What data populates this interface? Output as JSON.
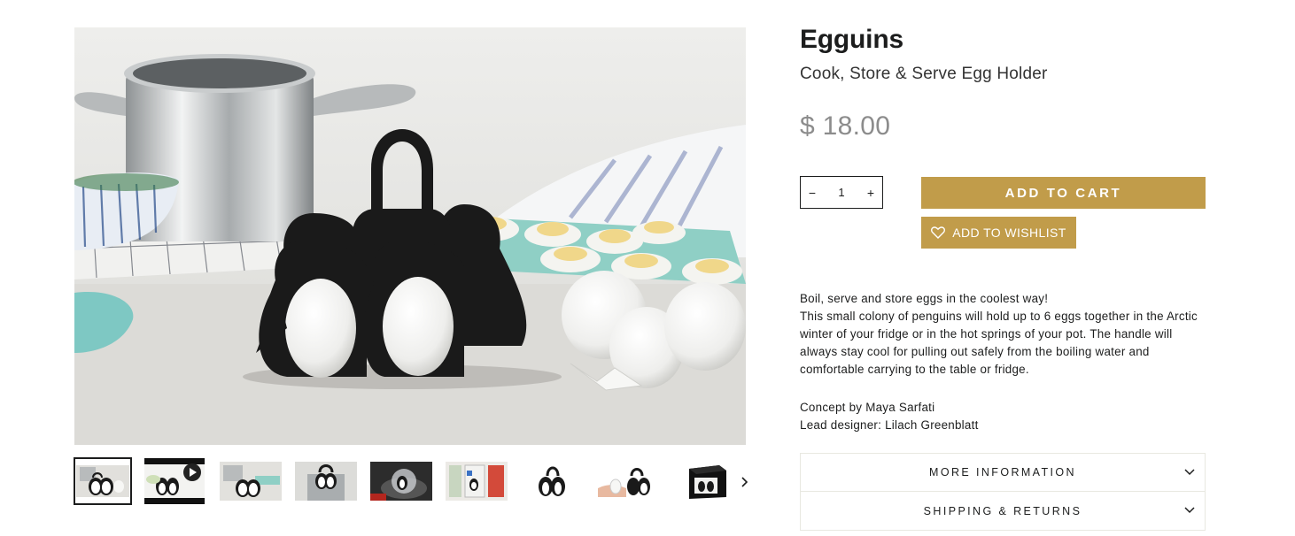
{
  "product": {
    "title": "Egguins",
    "subtitle": "Cook, Store & Serve Egg Holder",
    "price": "$ 18.00"
  },
  "quantity": {
    "value": "1",
    "decrement_symbol": "−",
    "increment_symbol": "+"
  },
  "buttons": {
    "add_to_cart": "ADD TO CART",
    "add_to_wishlist": "ADD TO WISHLIST"
  },
  "description": {
    "lines": [
      "Boil, serve and store eggs in the coolest way!",
      "This small colony of penguins will hold up to 6 eggs together in the Arctic winter of your fridge or in the hot springs of your pot. The handle will always stay cool for pulling out safely from the boiling water and comfortable carrying to the table or fridge."
    ],
    "credits": [
      "Concept by Maya Sarfati",
      "Lead designer: Lilach Greenblatt"
    ]
  },
  "accordion": [
    {
      "label": "MORE INFORMATION"
    },
    {
      "label": "SHIPPING & RETURNS"
    }
  ],
  "gallery": {
    "thumbnails": [
      {
        "type": "image",
        "active": true
      },
      {
        "type": "video",
        "active": false
      },
      {
        "type": "image",
        "active": false
      },
      {
        "type": "image",
        "active": false
      },
      {
        "type": "image",
        "active": false
      },
      {
        "type": "image",
        "active": false
      },
      {
        "type": "image",
        "active": false
      },
      {
        "type": "image",
        "active": false
      },
      {
        "type": "image",
        "active": false
      }
    ],
    "next_icon": "chevron-right-icon"
  },
  "colors": {
    "accent": "#c19c4a",
    "text": "#1c1d1d",
    "price": "#8c8c8c",
    "border": "#e8e8e1"
  },
  "icons": {
    "wishlist": "heart-outline-icon",
    "accordion": "chevron-down-icon",
    "video": "play-icon"
  }
}
